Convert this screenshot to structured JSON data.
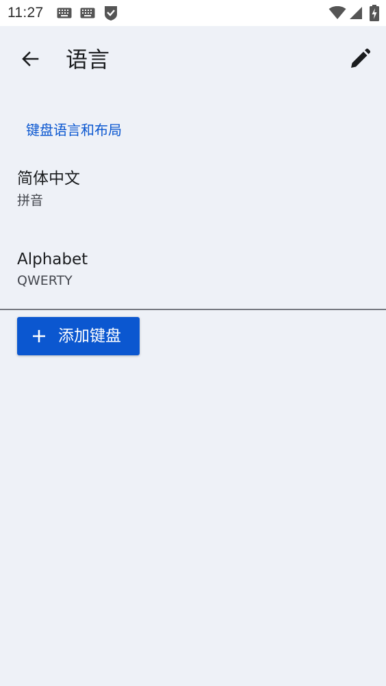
{
  "status_bar": {
    "time": "11:27",
    "icons": [
      "keyboard-icon",
      "keyboard-icon",
      "shield-check-icon",
      "wifi-icon",
      "cellular-signal-icon",
      "battery-charging-icon"
    ]
  },
  "app_bar": {
    "title": "语言",
    "back_icon": "arrow-back-icon",
    "edit_icon": "pencil-icon"
  },
  "section": {
    "header": "键盘语言和布局"
  },
  "languages": [
    {
      "name": "简体中文",
      "layout": "拼音"
    },
    {
      "name": "Alphabet",
      "layout": "QWERTY"
    }
  ],
  "add_button": {
    "label": "添加键盘",
    "icon": "plus-icon"
  },
  "colors": {
    "background": "#eef1f7",
    "accent": "#0b57d0",
    "status_bar": "#ffffff",
    "divider": "#74777f"
  }
}
